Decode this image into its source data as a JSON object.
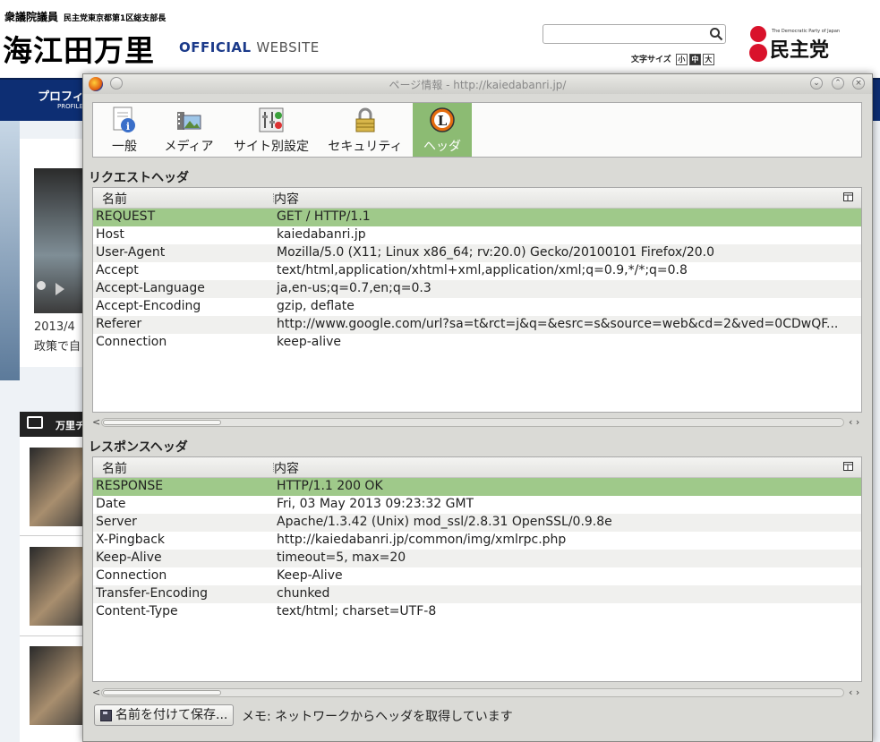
{
  "site": {
    "subtitle": "衆議院議員",
    "subtitle_small": "民主党東京都第1区総支部長",
    "name": "海江田万里",
    "official": "OFFICIAL",
    "website": "WEBSITE",
    "font_size_label": "文字サイズ",
    "font_sizes": [
      "小",
      "中",
      "大"
    ],
    "party_small": "The Democratic Party of Japan",
    "party_name": "民主党",
    "nav_item": "プロフィ",
    "nav_sub": "PROFILE",
    "video_date": "2013/4",
    "video_text": "政策で自",
    "list_head": "万里チ"
  },
  "dialog": {
    "title": "ページ情報 - http://kaiedabanri.jp/",
    "tabs": [
      {
        "label": "一般",
        "icon": "info-icon"
      },
      {
        "label": "メディア",
        "icon": "media-icon"
      },
      {
        "label": "サイト別設定",
        "icon": "permissions-icon"
      },
      {
        "label": "セキュリティ",
        "icon": "lock-icon"
      },
      {
        "label": "ヘッダ",
        "icon": "live-http-headers-icon",
        "active": true
      }
    ],
    "request_title": "リクエストヘッダ",
    "response_title": "レスポンスヘッダ",
    "col_name": "名前",
    "col_value": "内容",
    "request_rows": [
      {
        "name": "REQUEST",
        "value": "GET / HTTP/1.1"
      },
      {
        "name": "Host",
        "value": "kaiedabanri.jp"
      },
      {
        "name": "User-Agent",
        "value": "Mozilla/5.0 (X11; Linux x86_64; rv:20.0) Gecko/20100101 Firefox/20.0"
      },
      {
        "name": "Accept",
        "value": "text/html,application/xhtml+xml,application/xml;q=0.9,*/*;q=0.8"
      },
      {
        "name": "Accept-Language",
        "value": "ja,en-us;q=0.7,en;q=0.3"
      },
      {
        "name": "Accept-Encoding",
        "value": "gzip, deflate"
      },
      {
        "name": "Referer",
        "value": "http://www.google.com/url?sa=t&rct=j&q=&esrc=s&source=web&cd=2&ved=0CDwQF..."
      },
      {
        "name": "Connection",
        "value": "keep-alive"
      }
    ],
    "response_rows": [
      {
        "name": "RESPONSE",
        "value": "HTTP/1.1 200 OK"
      },
      {
        "name": "Date",
        "value": "Fri, 03 May 2013 09:23:32 GMT"
      },
      {
        "name": "Server",
        "value": "Apache/1.3.42 (Unix) mod_ssl/2.8.31 OpenSSL/0.9.8e"
      },
      {
        "name": "X-Pingback",
        "value": "http://kaiedabanri.jp/common/img/xmlrpc.php"
      },
      {
        "name": "Keep-Alive",
        "value": "timeout=5, max=20"
      },
      {
        "name": "Connection",
        "value": "Keep-Alive"
      },
      {
        "name": "Transfer-Encoding",
        "value": "chunked"
      },
      {
        "name": "Content-Type",
        "value": "text/html; charset=UTF-8"
      }
    ],
    "save_label": "名前を付けて保存...",
    "memo": "メモ: ネットワークからヘッダを取得しています"
  },
  "colors": {
    "selected_row": "#9fc98a",
    "active_tab": "#8cbb73",
    "nav_bg": "#0d2e73"
  }
}
